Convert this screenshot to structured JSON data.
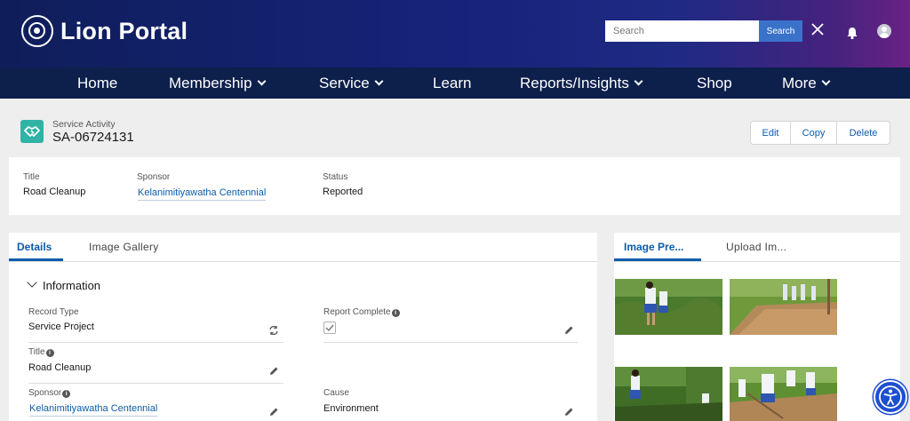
{
  "header": {
    "brand_name": "Lion Portal",
    "logo_icon": "lions-logo-icon",
    "search": {
      "placeholder": "Search",
      "button_label": "Search"
    }
  },
  "nav": {
    "items": [
      {
        "label": "Home",
        "has_menu": false
      },
      {
        "label": "Membership",
        "has_menu": true
      },
      {
        "label": "Service",
        "has_menu": true
      },
      {
        "label": "Learn",
        "has_menu": false
      },
      {
        "label": "Reports/Insights",
        "has_menu": true
      },
      {
        "label": "Shop",
        "has_menu": false
      },
      {
        "label": "More",
        "has_menu": true
      }
    ]
  },
  "record": {
    "object_type": "Service Activity",
    "id": "SA-06724131",
    "actions": {
      "edit": "Edit",
      "copy": "Copy",
      "delete": "Delete"
    }
  },
  "highlights": {
    "title_label": "Title",
    "title_value": "Road Cleanup",
    "sponsor_label": "Sponsor",
    "sponsor_value": "Kelanimitiyawatha Centennial",
    "status_label": "Status",
    "status_value": "Reported"
  },
  "tabs": {
    "details": "Details",
    "gallery": "Image Gallery"
  },
  "section": {
    "title": "Information",
    "fields": {
      "record_type_label": "Record Type",
      "record_type_value": "Service Project",
      "report_complete_label": "Report Complete",
      "report_complete_checked": true,
      "title_label": "Title",
      "title_value": "Road Cleanup",
      "sponsor_label": "Sponsor",
      "sponsor_value": "Kelanimitiyawatha Centennial",
      "cause_label": "Cause",
      "cause_value": "Environment"
    }
  },
  "side_tabs": {
    "preview": "Image Pre...",
    "upload": "Upload Im..."
  },
  "colors": {
    "brand_dark": "#0d1f4b",
    "accent_blue": "#0b5cab",
    "record_icon": "#30b3a4"
  }
}
